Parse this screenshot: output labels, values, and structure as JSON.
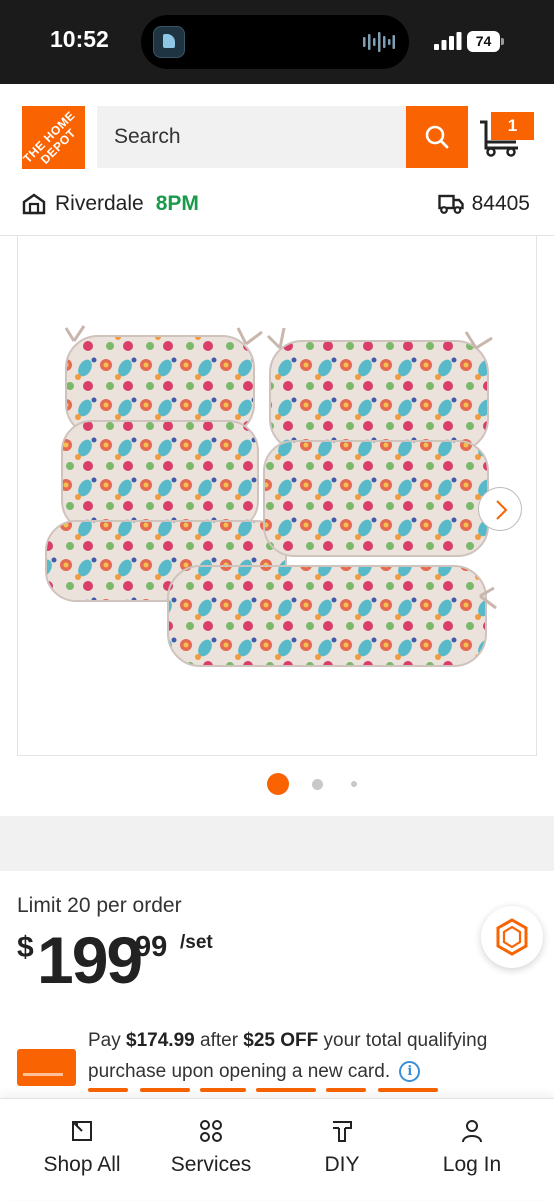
{
  "status_bar": {
    "time": "10:52",
    "battery": "74"
  },
  "header": {
    "logo_text": "THE HOME DEPOT",
    "search_placeholder": "Search",
    "cart_count": "1",
    "store_name": "Riverdale",
    "store_close_time": "8PM",
    "zip_code": "84405"
  },
  "gallery": {
    "image_count": 3,
    "active_index": 0
  },
  "colors": {
    "brand": "#f96302",
    "store_time": "#1a9b4b",
    "info": "#3a8fd6"
  },
  "pricing": {
    "limit": "Limit 20 per order",
    "currency": "$",
    "whole": "199",
    "cents": "99",
    "unit": "/set"
  },
  "promo": {
    "prefix": "Pay ",
    "pay_amount": "$174.99",
    "middle": " after ",
    "discount": "$25 OFF",
    "suffix": " your total qualifying purchase upon opening a new card."
  },
  "bottom_nav": [
    {
      "label": "Shop All",
      "icon": "shop-all-icon"
    },
    {
      "label": "Services",
      "icon": "services-icon"
    },
    {
      "label": "DIY",
      "icon": "diy-icon"
    },
    {
      "label": "Log In",
      "icon": "user-icon"
    }
  ]
}
